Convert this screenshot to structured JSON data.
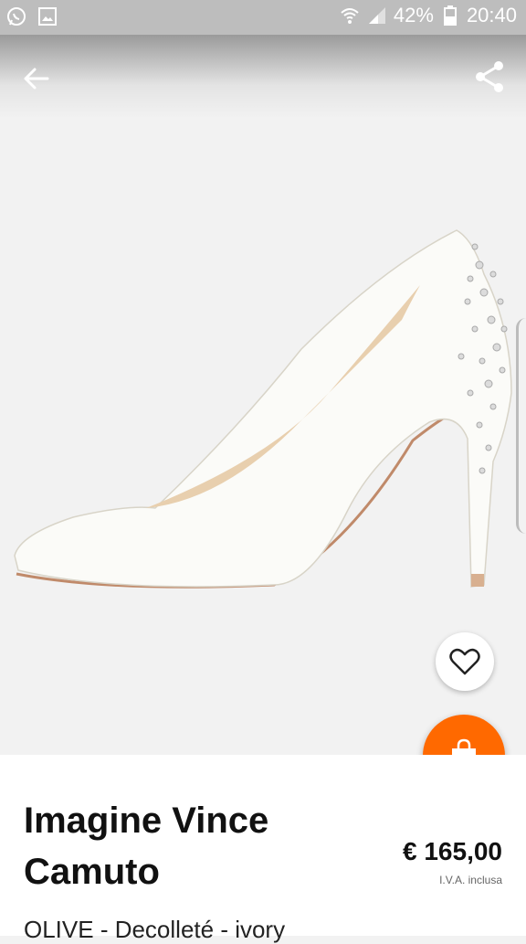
{
  "status_bar": {
    "battery": "42%",
    "time": "20:40"
  },
  "icons": {
    "back": "arrow-left-icon",
    "share": "share-icon",
    "favorite": "heart-icon",
    "cart": "shopping-bag-icon"
  },
  "colors": {
    "accent": "#ff6900",
    "status_bar": "#bdbdbd",
    "background": "#f2f2f2"
  },
  "product": {
    "brand": "Imagine Vince Camuto",
    "price": "€ 165,00",
    "vat_note": "I.V.A. inclusa",
    "subtitle": "OLIVE - Decolleté - ivory"
  }
}
